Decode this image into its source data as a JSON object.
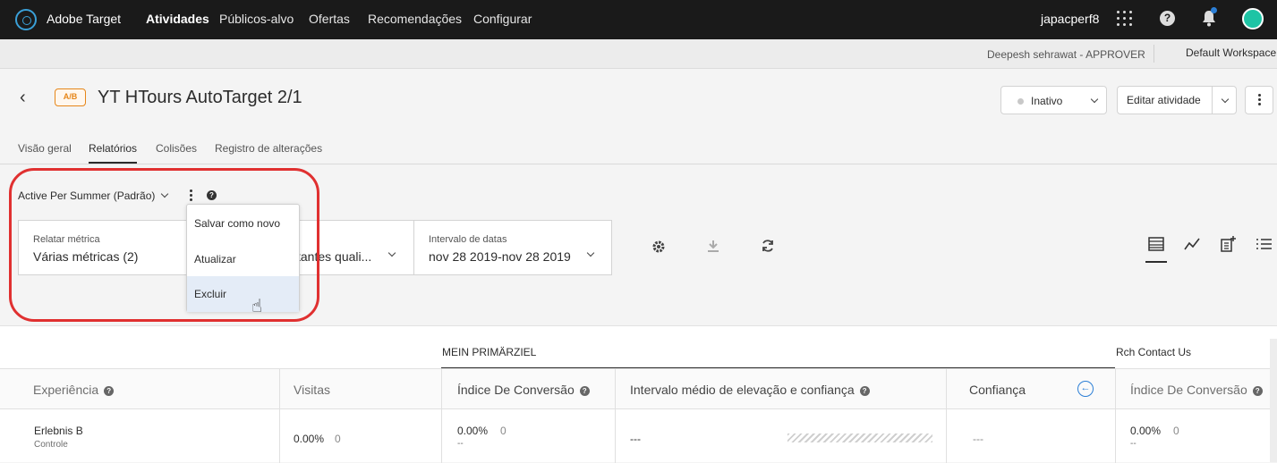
{
  "app": {
    "brand": "Adobe Target",
    "user": "japacperf8"
  },
  "nav": {
    "items": [
      "Atividades",
      "Públicos-alvo",
      "Ofertas",
      "Recomendações",
      "Configurar"
    ],
    "active": "Atividades"
  },
  "subbar": {
    "approver": "Deepesh sehrawat - APPROVER",
    "workspace": "Default Workspace"
  },
  "activity": {
    "badge": "A/B",
    "title": "YT HTours AutoTarget 2/1",
    "status": "Inativo",
    "edit_label": "Editar atividade"
  },
  "tabs": [
    "Visão geral",
    "Relatórios",
    "Colisões",
    "Registro de alterações"
  ],
  "report": {
    "selected": "Active Per Summer (Padrão)"
  },
  "filters": {
    "metric_caption": "Relatar métrica",
    "metric_value": "Várias métricas (2)",
    "audience_value_partial": "tantes quali...",
    "date_caption": "Intervalo de datas",
    "date_value": "nov 28 2019-nov 28 2019"
  },
  "menu": {
    "items": [
      "Salvar como novo",
      "Atualizar",
      "Excluir"
    ],
    "hovered": "Excluir"
  },
  "table": {
    "group_main": "MEIN PRIMÄRZIEL",
    "group_secondary": "Rch Contact Us",
    "headers": {
      "experience": "Experiência",
      "visits": "Visitas",
      "conversion_rate": "Índice De Conversão",
      "lift": "Intervalo médio de elevação e confiança",
      "confidence": "Confiança",
      "conversion_rate_2": "Índice De Conversão"
    },
    "row": {
      "experience": "Erlebnis B",
      "experience_sub": "Controle",
      "visits_pct": "0.00%",
      "visits_count": "0",
      "conv_pct": "0.00%",
      "conv_count": "0",
      "conv_sub": "--",
      "lift": "---",
      "confidence": "---",
      "conv2_pct": "0.00%",
      "conv2_count": "0",
      "conv2_sub": "--"
    }
  },
  "colors": {
    "accent": "#2c7fd6",
    "badge": "#e68619",
    "highlight_outline": "#e03030"
  }
}
